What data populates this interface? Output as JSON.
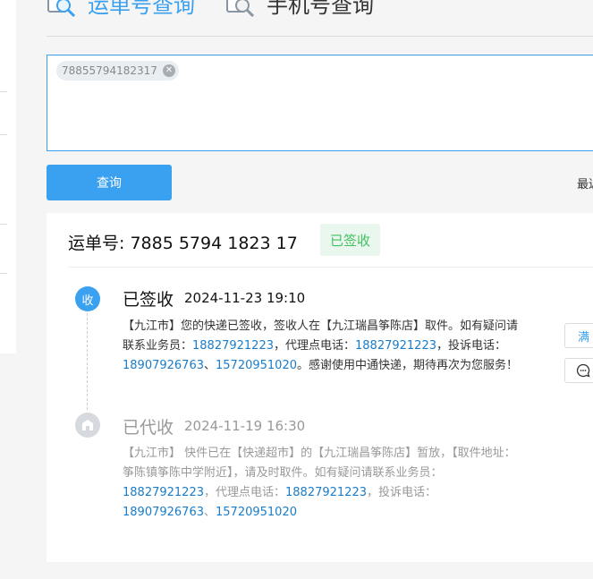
{
  "tabs": [
    {
      "label": "运单号查询",
      "active": true
    },
    {
      "label": "手机号查询",
      "active": false
    }
  ],
  "input": {
    "chip": "78855794182317"
  },
  "query_button": "查询",
  "latest_label": "最近",
  "result": {
    "waybill_label": "运单号: 7885 5794 1823 17",
    "status": "已签收",
    "events": [
      {
        "node": "收",
        "status": "已签收",
        "time": "2024-11-23 19:10",
        "text_parts": [
          {
            "t": "【九江市】您的快递已签收，签收人在【九江瑞昌筝陈店】取件。如有疑问请联系业务员：",
            "link": false
          },
          {
            "t": "18827921223",
            "link": true
          },
          {
            "t": "，代理点电话：",
            "link": false
          },
          {
            "t": "18827921223",
            "link": true
          },
          {
            "t": "，投诉电话：",
            "link": false
          },
          {
            "t": "18907926763",
            "link": true
          },
          {
            "t": "、",
            "link": false
          },
          {
            "t": "15720951020",
            "link": true
          },
          {
            "t": "。感谢使用中通快递，期待再次为您服务！",
            "link": false
          }
        ]
      },
      {
        "node": "",
        "status": "已代收",
        "time": "2024-11-19 16:30",
        "text_parts": [
          {
            "t": "【九江市】 快件已在【快递超市】的【九江瑞昌筝陈店】暂放，【取件地址：筝陈镇筝陈中学附近】，请及时取件。如有疑问请联系业务员：",
            "link": false
          },
          {
            "t": "18827921223",
            "link": true
          },
          {
            "t": "，代理点电话：",
            "link": false
          },
          {
            "t": "18827921223",
            "link": true
          },
          {
            "t": "，投诉电话：",
            "link": false
          },
          {
            "t": "18907926763",
            "link": true
          },
          {
            "t": "、",
            "link": false
          },
          {
            "t": "15720951020",
            "link": true
          }
        ]
      }
    ]
  },
  "side_buttons": [
    {
      "label": "满",
      "icon": ""
    },
    {
      "label": "",
      "icon": "chat-icon"
    }
  ],
  "colors": {
    "accent": "#3aa0f0",
    "success": "#44c061",
    "link": "#1a7cc8"
  }
}
